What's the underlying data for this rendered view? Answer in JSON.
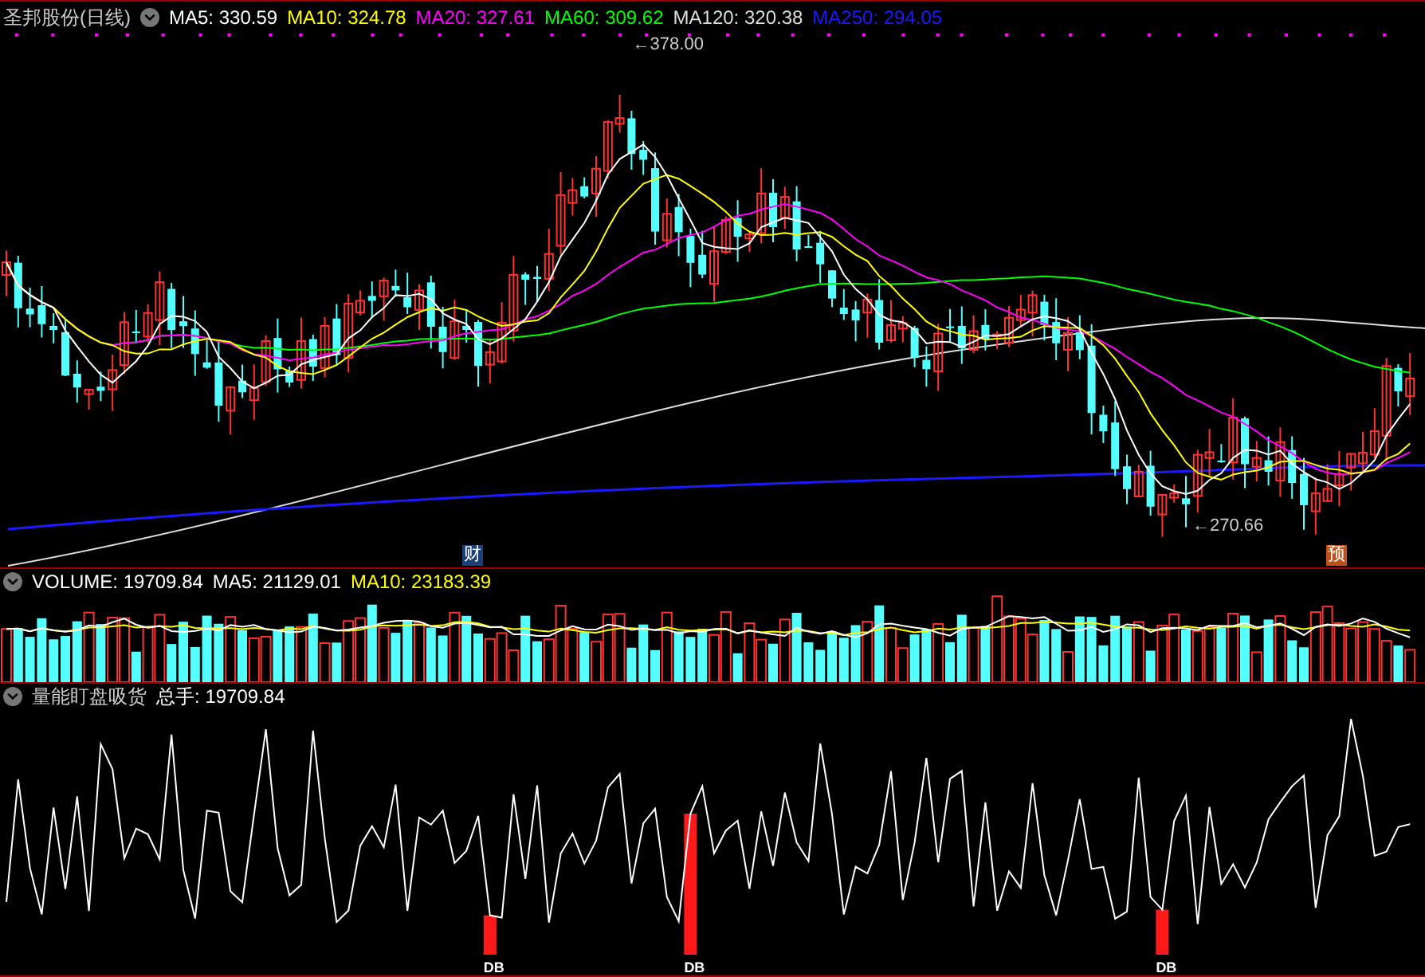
{
  "header": {
    "title": "圣邦股份(日线)",
    "items": [
      {
        "label": "MA5:",
        "value": "330.59",
        "color": "#ffffff"
      },
      {
        "label": "MA10:",
        "value": "324.78",
        "color": "#ffff00"
      },
      {
        "label": "MA20:",
        "value": "327.61",
        "color": "#ff00ff"
      },
      {
        "label": "MA60:",
        "value": "309.62",
        "color": "#00ff00"
      },
      {
        "label": "MA120:",
        "value": "320.38",
        "color": "#dddddd"
      },
      {
        "label": "MA250:",
        "value": "294.05",
        "color": "#1a1aff"
      }
    ]
  },
  "price_panel": {
    "high_label": "←378.00",
    "low_label": "←270.66",
    "markers": [
      {
        "text": "财",
        "color": "#1c3f78"
      },
      {
        "text": "预",
        "color": "#c0501a"
      }
    ]
  },
  "volume_panel": {
    "items": [
      {
        "label": "VOLUME:",
        "value": "19709.84",
        "color": "#ffffff"
      },
      {
        "label": "MA5:",
        "value": "21129.01",
        "color": "#ffffff"
      },
      {
        "label": "MA10:",
        "value": "23183.39",
        "color": "#ffff00"
      }
    ]
  },
  "indicator_panel": {
    "title": "量能盯盘吸货",
    "items": [
      {
        "label": "总手:",
        "value": "19709.84",
        "color": "#ffffff"
      }
    ],
    "signals": [
      {
        "label": "DB"
      },
      {
        "label": "DB"
      },
      {
        "label": "DB"
      }
    ]
  }
}
